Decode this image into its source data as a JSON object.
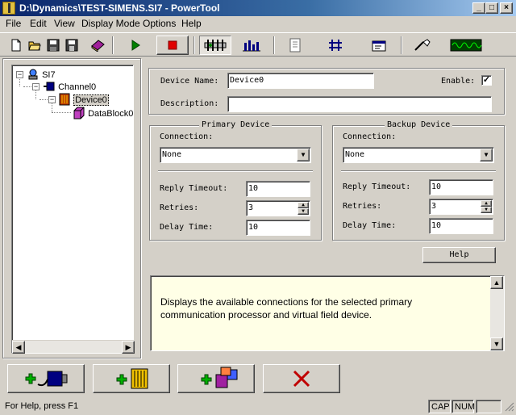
{
  "window": {
    "title": "D:\\Dynamics\\TEST-SIMENS.SI7 - PowerTool",
    "min_glyph": "_",
    "max_glyph": "□",
    "close_glyph": "×"
  },
  "menu": [
    {
      "label": "File"
    },
    {
      "label": "Edit"
    },
    {
      "label": "View"
    },
    {
      "label": "Display Mode"
    },
    {
      "label": "Options"
    },
    {
      "label": "Help"
    }
  ],
  "toolbar": {
    "icons": [
      "new-file-icon",
      "open-folder-icon",
      "save-icon",
      "save-all-icon",
      "book-icon",
      "run-icon",
      "stop-icon",
      "tags-icon",
      "chart-icon",
      "document-icon",
      "network-icon",
      "properties-icon",
      "probe-icon",
      "waveform-icon"
    ]
  },
  "tree": {
    "root": {
      "label": "SI7",
      "expander": "−"
    },
    "channel": {
      "label": "Channel0",
      "expander": "−"
    },
    "device": {
      "label": "Device0",
      "expander": "−"
    },
    "datablock": {
      "label": "DataBlock0"
    },
    "scroll_left": "◀",
    "scroll_right": "▶"
  },
  "device": {
    "name_label": "Device Name:",
    "name_value": "Device0",
    "enable_label": "Enable:",
    "enable_checked": "✓",
    "description_label": "Description:",
    "description_value": ""
  },
  "primary": {
    "title": "Primary Device",
    "connection_label": "Connection:",
    "connection_value": "None",
    "reply_timeout_label": "Reply Timeout:",
    "reply_timeout_value": "10",
    "retries_label": "Retries:",
    "retries_value": "3",
    "delay_time_label": "Delay Time:",
    "delay_time_value": "10"
  },
  "backup": {
    "title": "Backup Device",
    "connection_label": "Connection:",
    "connection_value": "None",
    "reply_timeout_label": "Reply Timeout:",
    "reply_timeout_value": "10",
    "retries_label": "Retries:",
    "retries_value": "3",
    "delay_time_label": "Delay Time:",
    "delay_time_value": "10"
  },
  "help_button": "Help",
  "help_text": "Displays the available connections for the selected primary communication processor and virtual field device.",
  "bottom_buttons": {
    "add_channel_icon": "add-channel-icon",
    "add_device_icon": "add-device-icon",
    "add_datablock_icon": "add-datablock-icon",
    "delete_icon": "delete-icon"
  },
  "status": {
    "text": "For Help, press F1",
    "cap": "CAP",
    "num": "NUM",
    "scrl": ""
  },
  "colors": {
    "titlebar": "#0a246a",
    "help_bg": "#ffffe6",
    "run_green": "#008000",
    "stop_red": "#e00000"
  }
}
